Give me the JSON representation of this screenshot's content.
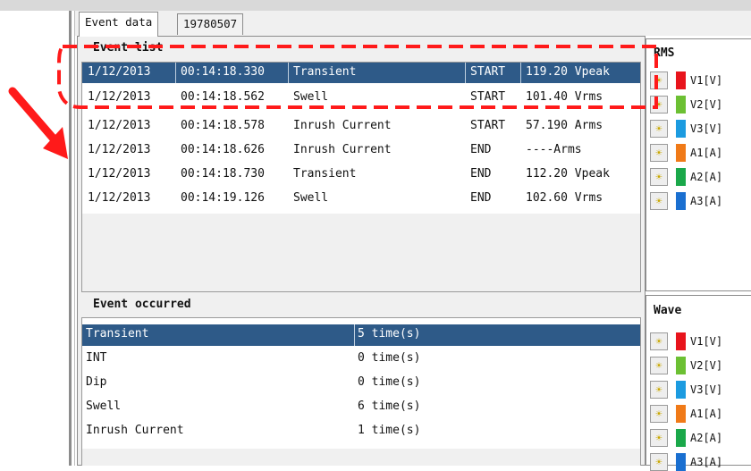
{
  "tabs": [
    {
      "label": "Event data",
      "active": true
    },
    {
      "label": "19780507",
      "active": false
    }
  ],
  "event_list": {
    "title": "Event list",
    "rows": [
      {
        "date": "1/12/2013",
        "time": "00:14:18.330",
        "type": "Transient",
        "state": "START",
        "value": "119.20 Vpeak",
        "selected": true
      },
      {
        "date": "1/12/2013",
        "time": "00:14:18.562",
        "type": "Swell",
        "state": "START",
        "value": "101.40 Vrms",
        "selected": false
      },
      {
        "date": "1/12/2013",
        "time": "00:14:18.578",
        "type": "Inrush Current",
        "state": "START",
        "value": "57.190 Arms",
        "selected": false
      },
      {
        "date": "1/12/2013",
        "time": "00:14:18.626",
        "type": "Inrush Current",
        "state": "END",
        "value": "----Arms",
        "selected": false
      },
      {
        "date": "1/12/2013",
        "time": "00:14:18.730",
        "type": "Transient",
        "state": "END",
        "value": "112.20 Vpeak",
        "selected": false
      },
      {
        "date": "1/12/2013",
        "time": "00:14:19.126",
        "type": "Swell",
        "state": "END",
        "value": "102.60 Vrms",
        "selected": false
      }
    ]
  },
  "event_occurred": {
    "title": "Event occurred",
    "rows": [
      {
        "name": "Transient",
        "count": "5 time(s)",
        "selected": true
      },
      {
        "name": "INT",
        "count": "0 time(s)",
        "selected": false
      },
      {
        "name": "Dip",
        "count": "0 time(s)",
        "selected": false
      },
      {
        "name": "Swell",
        "count": "6 time(s)",
        "selected": false
      },
      {
        "name": "Inrush Current",
        "count": "1 time(s)",
        "selected": false
      }
    ]
  },
  "rms_panel": {
    "title": "RMS",
    "channels": [
      {
        "label": "V1[V]",
        "color": "#e8141c",
        "icon": "bulb-icon"
      },
      {
        "label": "V2[V]",
        "color": "#6cc033",
        "icon": "bulb-icon"
      },
      {
        "label": "V3[V]",
        "color": "#1c9be0",
        "icon": "bulb-icon"
      },
      {
        "label": "A1[A]",
        "color": "#f07a18",
        "icon": "bulb-icon"
      },
      {
        "label": "A2[A]",
        "color": "#1aa84a",
        "icon": "bulb-icon"
      },
      {
        "label": "A3[A]",
        "color": "#1a6fd0",
        "icon": "bulb-icon"
      }
    ]
  },
  "wave_panel": {
    "title": "Wave",
    "channels": [
      {
        "label": "V1[V]",
        "color": "#e8141c",
        "icon": "bulb-icon"
      },
      {
        "label": "V2[V]",
        "color": "#6cc033",
        "icon": "bulb-icon"
      },
      {
        "label": "V3[V]",
        "color": "#1c9be0",
        "icon": "bulb-icon"
      },
      {
        "label": "A1[A]",
        "color": "#f07a18",
        "icon": "bulb-icon"
      },
      {
        "label": "A2[A]",
        "color": "#1aa84a",
        "icon": "bulb-icon"
      },
      {
        "label": "A3[A]",
        "color": "#1a6fd0",
        "icon": "bulb-icon"
      }
    ]
  },
  "colors": {
    "selection": "#2e5a88",
    "annotation": "#ff1a1a"
  }
}
